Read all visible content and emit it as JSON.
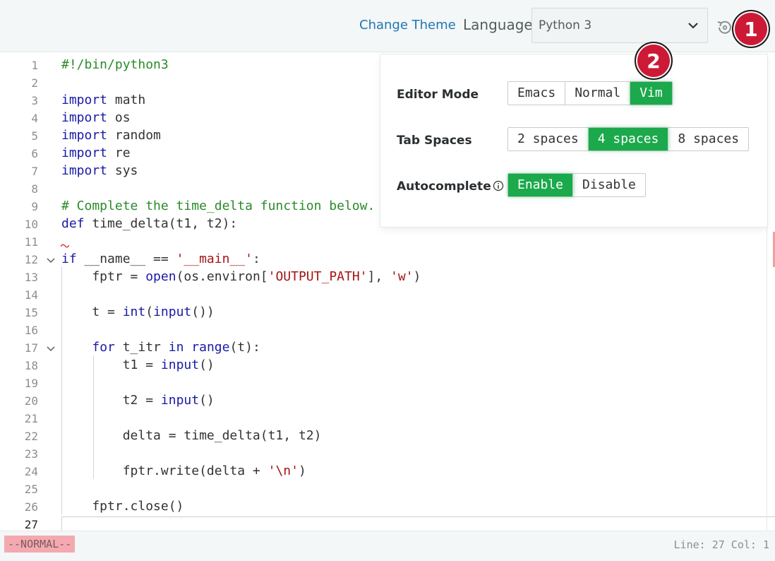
{
  "header": {
    "change_theme": "Change Theme",
    "language_label": "Language",
    "language_value": "Python 3",
    "reset_icon": "history-icon"
  },
  "markers": {
    "m1": "1",
    "m2": "2"
  },
  "settings": {
    "editor_mode": {
      "label": "Editor Mode",
      "options": [
        "Emacs",
        "Normal",
        "Vim"
      ],
      "selected": "Vim"
    },
    "tab_spaces": {
      "label": "Tab Spaces",
      "options": [
        "2 spaces",
        "4 spaces",
        "8 spaces"
      ],
      "selected": "4 spaces"
    },
    "autocomplete": {
      "label": "Autocomplete",
      "options": [
        "Enable",
        "Disable"
      ],
      "selected": "Enable",
      "info_icon": "info-icon"
    }
  },
  "editor": {
    "line_numbers": [
      "1",
      "2",
      "3",
      "4",
      "5",
      "6",
      "7",
      "8",
      "9",
      "10",
      "11",
      "12",
      "13",
      "14",
      "15",
      "16",
      "17",
      "18",
      "19",
      "20",
      "21",
      "22",
      "23",
      "24",
      "25",
      "26",
      "27"
    ],
    "lines": [
      "#!/bin/python3",
      "",
      "import math",
      "import os",
      "import random",
      "import re",
      "import sys",
      "",
      "# Complete the time_delta function below.",
      "def time_delta(t1, t2):",
      "",
      "if __name__ == '__main__':",
      "    fptr = open(os.environ['OUTPUT_PATH'], 'w')",
      "",
      "    t = int(input())",
      "",
      "    for t_itr in range(t):",
      "        t1 = input()",
      "",
      "        t2 = input()",
      "",
      "        delta = time_delta(t1, t2)",
      "",
      "        fptr.write(delta + '\\n')",
      "",
      "    fptr.close()",
      ""
    ]
  },
  "status": {
    "mode": "--NORMAL--",
    "position": "Line: 27 Col: 1"
  },
  "colors": {
    "accent": "#1ba94c",
    "marker": "#cc1a36",
    "link": "#1f77b4"
  }
}
